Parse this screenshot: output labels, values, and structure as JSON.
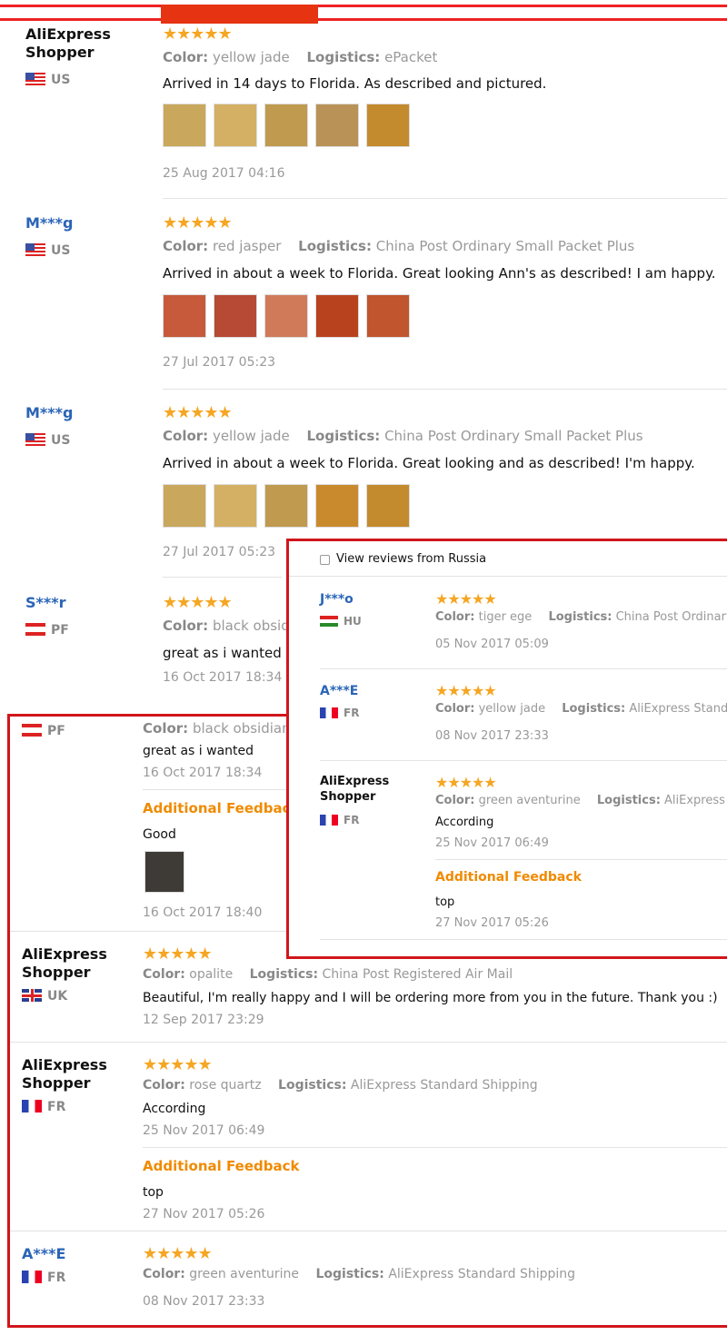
{
  "colors": {
    "accent": "#e63312",
    "star": "#f5a623",
    "link": "#2a64b7",
    "feedback": "#f08a00",
    "highlight_border": "#d0161b"
  },
  "stars_text": "★★★★★",
  "labels": {
    "color": "Color:",
    "logistics": "Logistics:",
    "additional_feedback": "Additional Feedback"
  },
  "reviews": [
    {
      "name_line1": "AliExpress",
      "name_line2": "Shopper",
      "country": "US",
      "flag": "us",
      "color": "yellow jade",
      "logistics": "ePacket",
      "text": "Arrived in 14 days to Florida. As described and pictured.",
      "date": "25 Aug 2017 04:16",
      "rating": 5
    },
    {
      "name": "M***g",
      "country": "US",
      "flag": "us",
      "color": "red jasper",
      "logistics": "China Post Ordinary Small Packet Plus",
      "text": "Arrived in about a week to Florida. Great looking Ann's as described! I am happy.",
      "date": "27 Jul 2017 05:23",
      "rating": 5
    },
    {
      "name": "M***g",
      "country": "US",
      "flag": "us",
      "color": "yellow jade",
      "logistics": "China Post Ordinary Small Packet Plus",
      "text": "Arrived in about a week to Florida. Great looking and as described! I'm happy.",
      "date": "27 Jul 2017 05:23",
      "rating": 5
    },
    {
      "name": "S***r",
      "country": "PF",
      "flag": "pf",
      "color": "black obsid",
      "text": "great as i wanted",
      "date": "16 Oct 2017 18:34",
      "rating": 5
    }
  ],
  "bottom_box": {
    "first": {
      "country": "PF",
      "color": "black obsidian",
      "text": "great as i wanted",
      "date": "16 Oct 2017 18:34",
      "feedback_text": "Good",
      "feedback_date": "16 Oct 2017 18:40"
    },
    "items": [
      {
        "name_line1": "AliExpress",
        "name_line2": "Shopper",
        "country": "UK",
        "flag": "uk",
        "color": "opalite",
        "logistics": "China Post Registered Air Mail",
        "text": "Beautiful, I'm really happy and I will be ordering more from you in the future. Thank you :)",
        "date": "12 Sep 2017 23:29",
        "rating": 5
      },
      {
        "name_line1": "AliExpress",
        "name_line2": "Shopper",
        "country": "FR",
        "flag": "fr",
        "color": "rose quartz",
        "logistics": "AliExpress Standard Shipping",
        "text": "According",
        "date": "25 Nov 2017 06:49",
        "feedback_text": "top",
        "feedback_date": "27 Nov 2017 05:26",
        "rating": 5
      },
      {
        "name": "A***E",
        "country": "FR",
        "flag": "fr",
        "color": "green aventurine",
        "logistics": "AliExpress Standard Shipping",
        "date": "08 Nov 2017 23:33",
        "rating": 5
      }
    ]
  },
  "right_box": {
    "filter_label": "View reviews from Russia",
    "items": [
      {
        "name": "J***o",
        "country": "HU",
        "flag": "hu",
        "color": "tiger ege",
        "logistics": "China Post Ordinary Sm",
        "date": "05 Nov 2017 05:09",
        "rating": 5
      },
      {
        "name": "A***E",
        "country": "FR",
        "flag": "fr",
        "color": "yellow jade",
        "logistics": "AliExpress Standard",
        "date": "08 Nov 2017 23:33",
        "rating": 5
      },
      {
        "name_line1": "AliExpress",
        "name_line2": "Shopper",
        "country": "FR",
        "flag": "fr",
        "color": "green aventurine",
        "logistics": "AliExpress Star",
        "text": "According",
        "date": "25 Nov 2017 06:49",
        "feedback_text": "top",
        "feedback_date": "27 Nov 2017 05:26",
        "rating": 5
      }
    ]
  }
}
